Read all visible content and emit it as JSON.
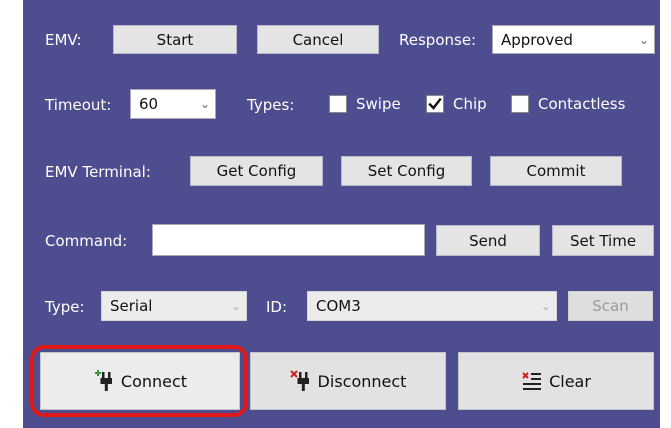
{
  "emv": {
    "label": "EMV:",
    "start_label": "Start",
    "cancel_label": "Cancel",
    "response_label": "Response:",
    "response_value": "Approved"
  },
  "timeout": {
    "label": "Timeout:",
    "value": "60",
    "types_label": "Types:",
    "types": [
      {
        "label": "Swipe",
        "checked": false
      },
      {
        "label": "Chip",
        "checked": true
      },
      {
        "label": "Contactless",
        "checked": false
      }
    ]
  },
  "terminal": {
    "label": "EMV Terminal:",
    "get_config_label": "Get Config",
    "set_config_label": "Set Config",
    "commit_label": "Commit"
  },
  "command": {
    "label": "Command:",
    "value": "",
    "send_label": "Send",
    "set_time_label": "Set Time"
  },
  "connection": {
    "type_label": "Type:",
    "type_value": "Serial",
    "id_label": "ID:",
    "id_value": "COM3",
    "scan_label": "Scan"
  },
  "actions": {
    "connect_label": "Connect",
    "disconnect_label": "Disconnect",
    "clear_label": "Clear"
  },
  "colors": {
    "panel_bg": "#4d4d8f",
    "highlight": "#e01818",
    "connect_icon_accent": "#2e9a2e",
    "disconnect_icon_accent": "#d02020"
  },
  "icons": {
    "connect": "plug-plus-icon",
    "disconnect": "plug-x-icon",
    "clear": "clear-lines-icon",
    "checkbox_check": "check-icon",
    "dropdown": "chevron-down-icon"
  }
}
